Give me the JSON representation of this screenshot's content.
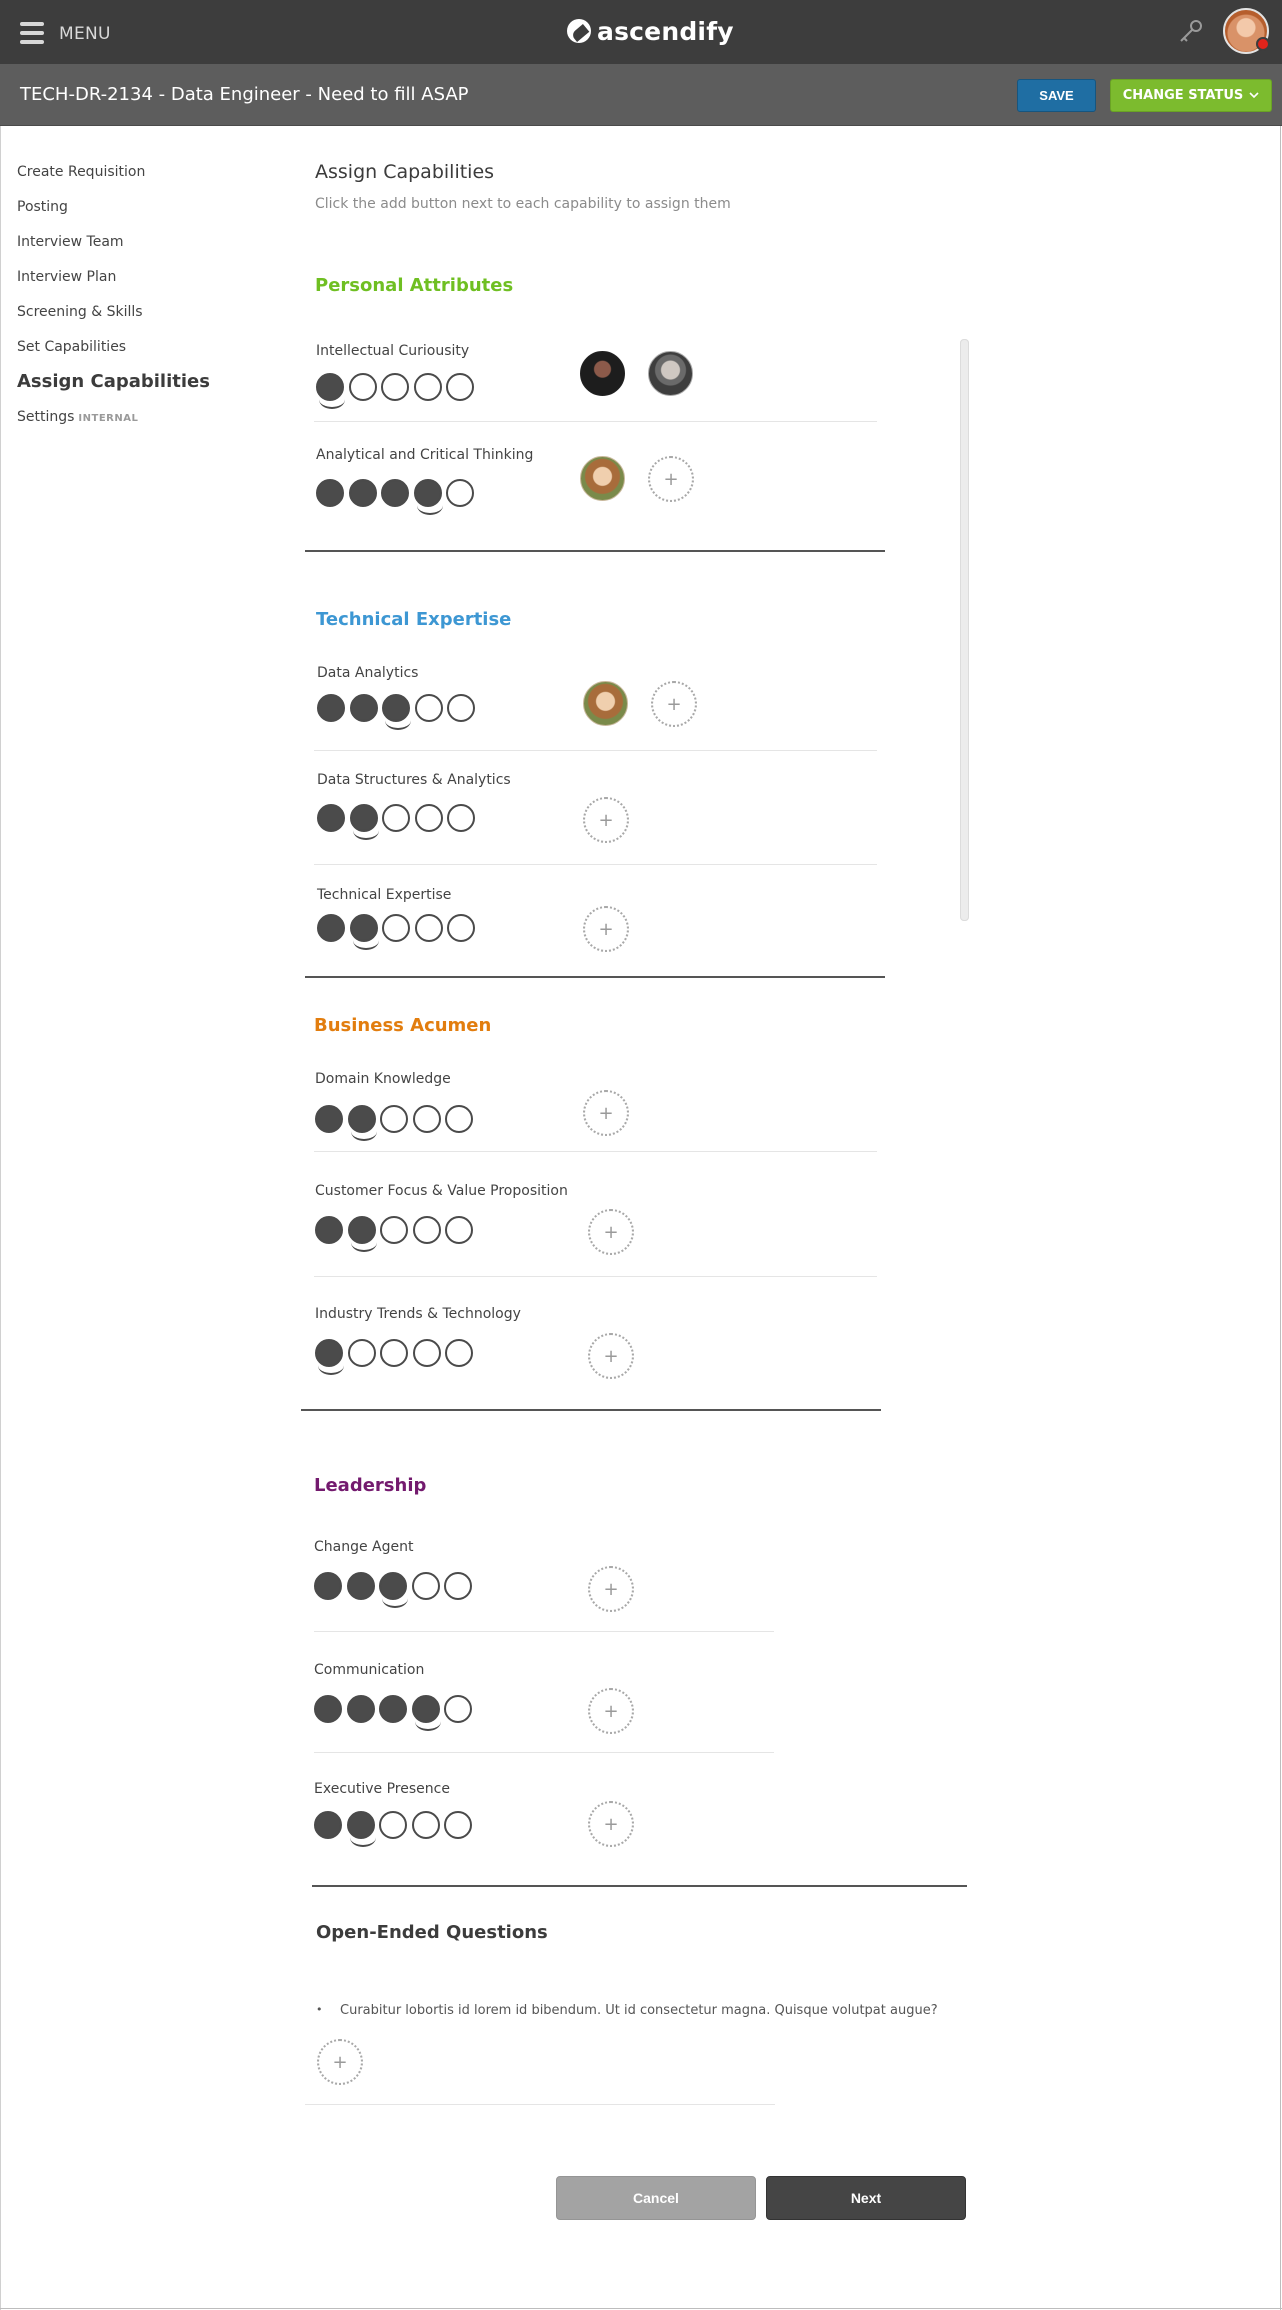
{
  "app": {
    "menu_label": "MENU",
    "brand": "ascendify"
  },
  "header": {
    "requisition_title": "TECH-DR-2134 - Data Engineer - Need to fill ASAP",
    "save_label": "SAVE",
    "change_status_label": "CHANGE STATUS",
    "save_color": "#1f6ea3",
    "status_color": "#7cbb2e"
  },
  "sidebar": {
    "items": [
      {
        "label": "Create Requisition"
      },
      {
        "label": "Posting"
      },
      {
        "label": "Interview Team"
      },
      {
        "label": "Interview Plan"
      },
      {
        "label": "Screening & Skills"
      },
      {
        "label": "Set Capabilities"
      },
      {
        "label": "Assign Capabilities",
        "active": true
      },
      {
        "label": "Settings",
        "badge": "INTERNAL"
      }
    ]
  },
  "main": {
    "title": "Assign Capabilities",
    "subtitle": "Click the add button next to each capability to assign them",
    "sections": [
      {
        "title": "Personal Attributes",
        "color": "#6fbf22",
        "capabilities": [
          {
            "label": "Intellectual Curiousity",
            "level": 1,
            "assignees": [
              "avatar-dark",
              "avatar-beard"
            ]
          },
          {
            "label": "Analytical and Critical Thinking",
            "level": 4,
            "assignees": [
              "avatar-girl"
            ]
          }
        ]
      },
      {
        "title": "Technical Expertise",
        "color": "#3d97d3",
        "capabilities": [
          {
            "label": "Data Analytics",
            "level": 3,
            "assignees": [
              "avatar-girl"
            ]
          },
          {
            "label": "Data Structures & Analytics",
            "level": 2,
            "assignees": []
          },
          {
            "label": "Technical Expertise",
            "level": 2,
            "assignees": []
          }
        ]
      },
      {
        "title": "Business Acumen",
        "color": "#e27d0e",
        "capabilities": [
          {
            "label": "Domain Knowledge",
            "level": 2,
            "assignees": []
          },
          {
            "label": "Customer Focus & Value Proposition",
            "level": 2,
            "assignees": []
          },
          {
            "label": "Industry Trends & Technology",
            "level": 1,
            "assignees": []
          }
        ]
      },
      {
        "title": "Leadership",
        "color": "#731a6e",
        "capabilities": [
          {
            "label": "Change Agent",
            "level": 3,
            "assignees": []
          },
          {
            "label": "Communication",
            "level": 4,
            "assignees": []
          },
          {
            "label": "Executive Presence",
            "level": 2,
            "assignees": []
          }
        ]
      }
    ],
    "rating_scale_max": 5,
    "add_symbol": "+",
    "open_ended": {
      "title": "Open-Ended Questions",
      "bullet": "•",
      "question": "Curabitur lobortis id lorem id bibendum. Ut id consectetur magna. Quisque volutpat augue?"
    }
  },
  "footer": {
    "cancel_label": "Cancel",
    "next_label": "Next"
  }
}
